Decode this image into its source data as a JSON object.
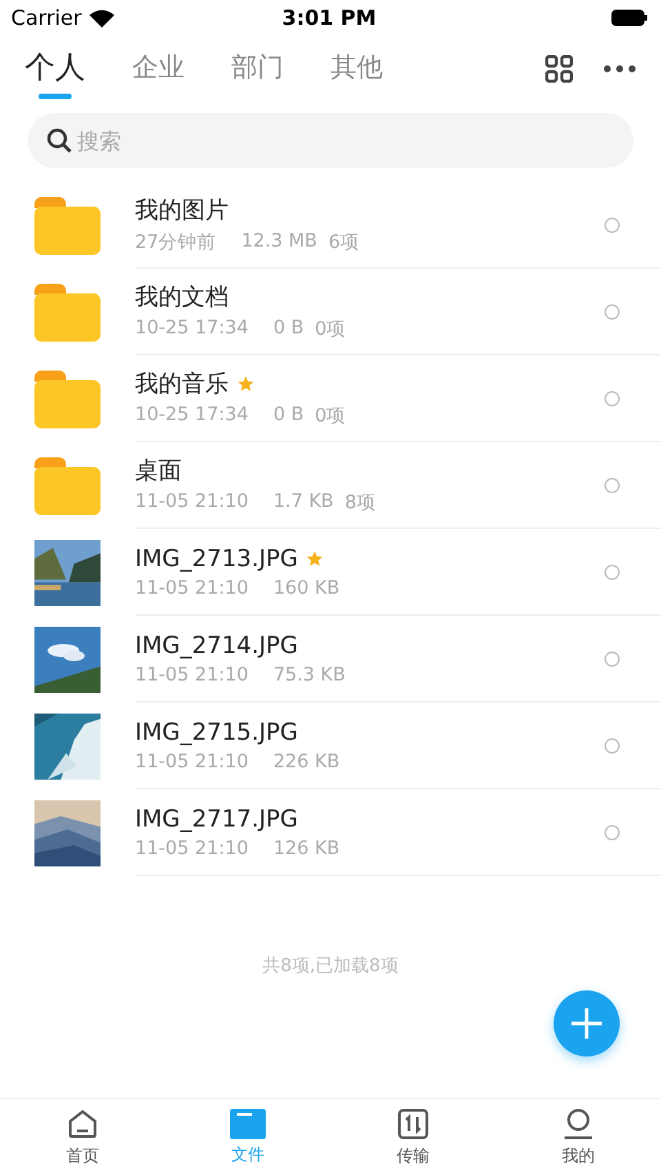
{
  "status_bar": {
    "carrier": "Carrier",
    "time": "3:01 PM"
  },
  "tabs": [
    {
      "label": "个人",
      "selected": true
    },
    {
      "label": "企业",
      "selected": false
    },
    {
      "label": "部门",
      "selected": false
    },
    {
      "label": "其他",
      "selected": false
    }
  ],
  "search": {
    "placeholder": "搜索"
  },
  "files": [
    {
      "kind": "folder",
      "name": "我的图片",
      "time": "27分钟前",
      "size": "12.3 MB",
      "count": "6项",
      "starred": false,
      "selected": false
    },
    {
      "kind": "folder",
      "name": "我的文档",
      "time": "10-25 17:34",
      "size": "0 B",
      "count": "0项",
      "starred": false,
      "selected": false
    },
    {
      "kind": "folder",
      "name": "我的音乐",
      "time": "10-25 17:34",
      "size": "0 B",
      "count": "0项",
      "starred": true,
      "selected": false
    },
    {
      "kind": "folder",
      "name": "桌面",
      "time": "11-05 21:10",
      "size": "1.7 KB",
      "count": "8项",
      "starred": false,
      "selected": false
    },
    {
      "name": "IMG_2713.JPG",
      "time": "11-05 21:10",
      "size": "160 KB",
      "starred": true,
      "selected": false
    },
    {
      "name": "IMG_2714.JPG",
      "time": "11-05 21:10",
      "size": "75.3 KB",
      "starred": false,
      "selected": false
    },
    {
      "name": "IMG_2715.JPG",
      "time": "11-05 21:10",
      "size": "226 KB",
      "starred": false,
      "selected": false
    },
    {
      "name": "IMG_2717.JPG",
      "time": "11-05 21:10",
      "size": "126 KB",
      "starred": false,
      "selected": false
    }
  ],
  "footer": "共8项,已加载8项",
  "bottom_nav": [
    {
      "label": "首页",
      "selected": false
    },
    {
      "label": "文件",
      "selected": true
    },
    {
      "label": "传输",
      "selected": false
    },
    {
      "label": "我的",
      "selected": false
    }
  ]
}
